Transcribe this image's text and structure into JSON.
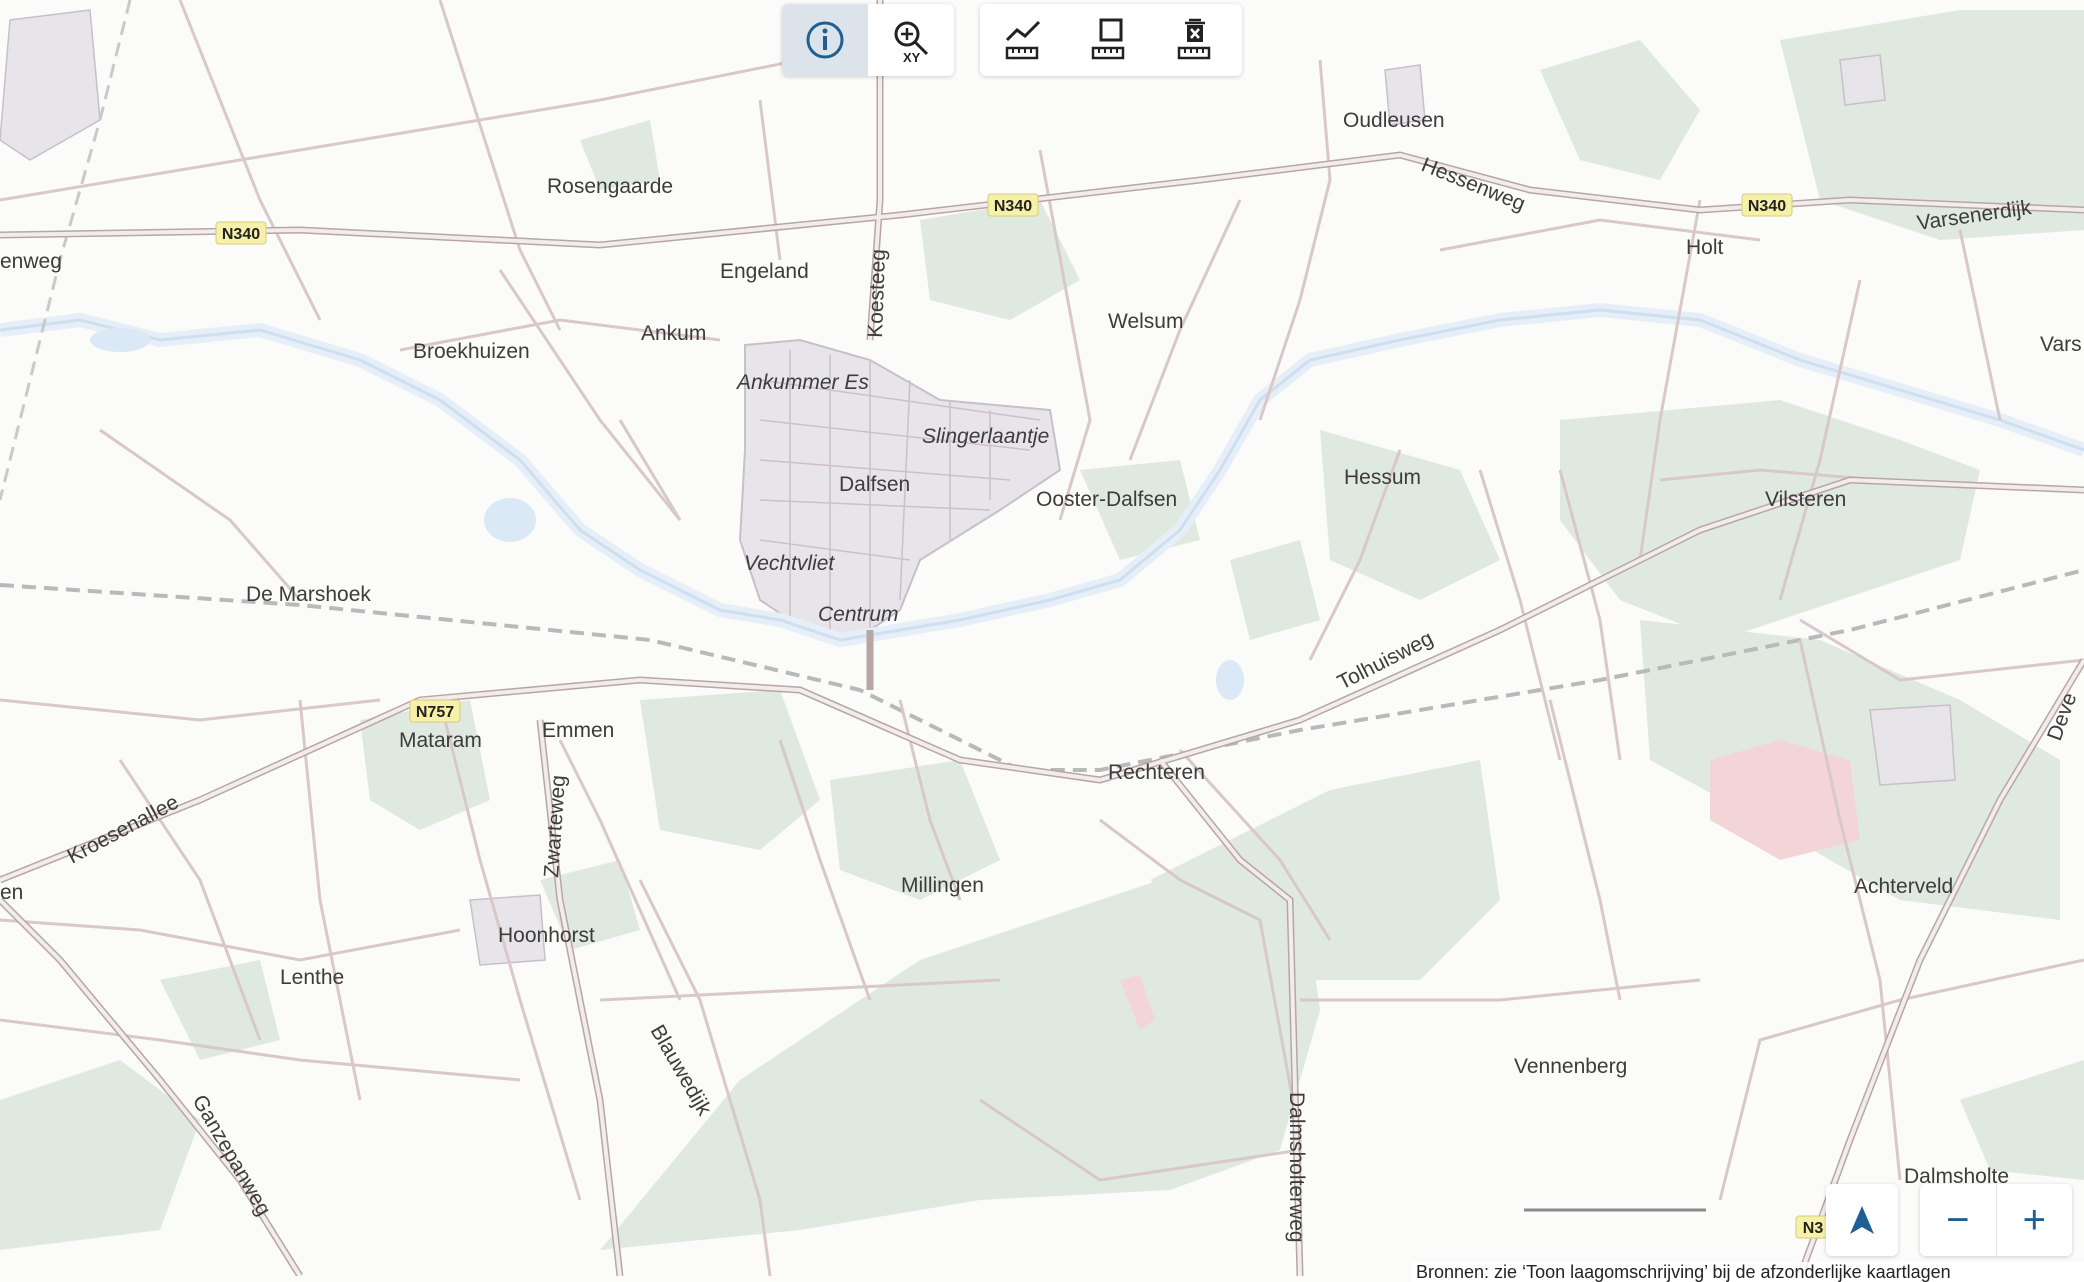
{
  "toolbar": {
    "tools": [
      {
        "name": "info-icon",
        "active": true
      },
      {
        "name": "zoom-to-coordinate-icon",
        "badge": "XY"
      },
      {
        "name": "measure-distance-icon"
      },
      {
        "name": "measure-area-icon"
      },
      {
        "name": "delete-measurement-icon"
      }
    ]
  },
  "controls": {
    "locate_icon": "navigation-arrow-icon",
    "zoom_out": "−",
    "zoom_in": "+"
  },
  "attribution": "Bronnen: zie ‘Toon laagomschrijving’ bij de afzonderlijke kaartlagen",
  "places": {
    "oudleusen": "Oudleusen",
    "rosengaarde": "Rosengaarde",
    "engeland": "Engeland",
    "ankum": "Ankum",
    "broekhuizen": "Broekhuizen",
    "welsum": "Welsum",
    "holt": "Holt",
    "vars": "Vars",
    "hessum": "Hessum",
    "vilsteren": "Vilsteren",
    "dalfsen": "Dalfsen",
    "ooster_dalfsen": "Ooster-Dalfsen",
    "de_marshoek": "De Marshoek",
    "mataram": "Mataram",
    "emmen": "Emmen",
    "rechteren": "Rechteren",
    "millingen": "Millingen",
    "achterveld": "Achterveld",
    "hoonhorst": "Hoonhorst",
    "lenthe": "Lenthe",
    "vennenberg": "Vennenberg",
    "dalmsholte": "Dalmsholte",
    "en_left": "en"
  },
  "neighbourhoods": {
    "ankummer_es": "Ankummer Es",
    "slingerlaantje": "Slingerlaantje",
    "vechtvliet": "Vechtvliet",
    "centrum": "Centrum"
  },
  "roads": {
    "enweg": "enweg",
    "hessenweg": "Hessenweg",
    "varsenerdijk": "Varsenerdijk",
    "koesteeg": "Koesteeg",
    "tolhuisweg": "Tolhuisweg",
    "kroesenallee": "Kroesenallee",
    "zwarteweg": "Zwarteweg",
    "blauwedijk": "Blauwedijk",
    "ganzepanweg": "Ganzepanweg",
    "dalmsholterweg": "Dalmsholterweg",
    "deve": "Deve"
  },
  "shields": {
    "n340_a": "N340",
    "n340_b": "N340",
    "n340_c": "N340",
    "n757": "N757",
    "n3_partial": "N3"
  },
  "colors": {
    "forest": "#dfe9df",
    "water": "#e6eff8",
    "built": "#e7e5ea",
    "road": "#d9c8c8",
    "road_outline": "#b8a6a6",
    "rail": "#b9b9b9",
    "accent": "#1f5f93",
    "shield": "#f7f0a8"
  }
}
